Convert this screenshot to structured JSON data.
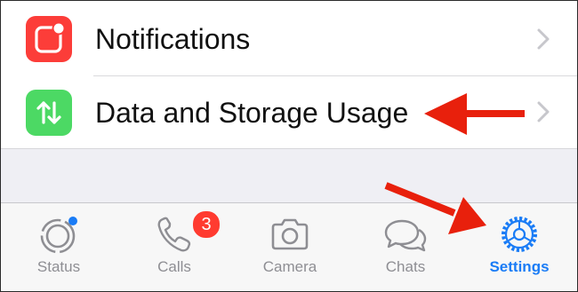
{
  "settings": {
    "rows": [
      {
        "label": "Notifications",
        "icon": "notifications-icon",
        "icon_color": "#fc3d39"
      },
      {
        "label": "Data and Storage Usage",
        "icon": "data-storage-icon",
        "icon_color": "#4cd964"
      }
    ]
  },
  "tab_bar": {
    "tabs": [
      {
        "label": "Status",
        "icon": "status-icon",
        "active": false
      },
      {
        "label": "Calls",
        "icon": "phone-icon",
        "active": false,
        "badge": "3"
      },
      {
        "label": "Camera",
        "icon": "camera-icon",
        "active": false
      },
      {
        "label": "Chats",
        "icon": "chats-icon",
        "active": false
      },
      {
        "label": "Settings",
        "icon": "gear-icon",
        "active": true
      }
    ]
  },
  "colors": {
    "accent": "#1a7cf6",
    "badge": "#ff3b30",
    "annotation_arrow": "#e8200c",
    "inactive_tab": "#8e8e93"
  }
}
